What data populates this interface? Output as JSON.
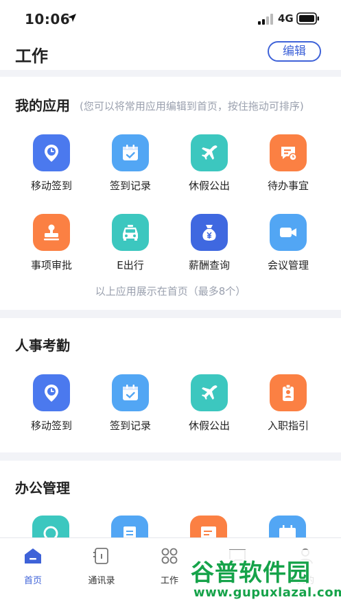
{
  "status": {
    "time": "10:06",
    "network": "4G"
  },
  "header": {
    "title": "工作",
    "edit_label": "编辑"
  },
  "my_apps": {
    "title": "我的应用",
    "hint": "(您可以将常用应用编辑到首页，按住拖动可排序)",
    "items": [
      {
        "label": "移动签到",
        "icon": "location-clock-icon",
        "color": "#4b79ee"
      },
      {
        "label": "签到记录",
        "icon": "calendar-check-icon",
        "color": "#52a6f4"
      },
      {
        "label": "休假公出",
        "icon": "airplane-icon",
        "color": "#3cc7bf"
      },
      {
        "label": "待办事宜",
        "icon": "todo-icon",
        "color": "#fb8043"
      },
      {
        "label": "事项审批",
        "icon": "stamp-icon",
        "color": "#fb8043"
      },
      {
        "label": "E出行",
        "icon": "taxi-icon",
        "color": "#3cc7bf"
      },
      {
        "label": "薪酬查询",
        "icon": "money-bag-icon",
        "color": "#3f68e0"
      },
      {
        "label": "会议管理",
        "icon": "video-camera-icon",
        "color": "#52a6f4"
      }
    ],
    "footnote": "以上应用展示在首页（最多8个）"
  },
  "hr": {
    "title": "人事考勤",
    "items": [
      {
        "label": "移动签到",
        "icon": "location-clock-icon"
      },
      {
        "label": "签到记录",
        "icon": "calendar-check-icon"
      },
      {
        "label": "休假公出",
        "icon": "airplane-icon"
      },
      {
        "label": "入职指引",
        "icon": "badge-icon"
      }
    ]
  },
  "office": {
    "title": "办公管理"
  },
  "tabs": [
    {
      "label": "首页",
      "icon": "home-icon",
      "active": true
    },
    {
      "label": "通讯录",
      "icon": "contacts-icon",
      "active": false
    },
    {
      "label": "工作",
      "icon": "grid-icon",
      "active": false
    },
    {
      "label": "",
      "icon": "message-icon",
      "active": false
    },
    {
      "label": "我的",
      "icon": "user-icon",
      "active": false
    }
  ],
  "watermark": {
    "title": "谷普软件园",
    "url": "www.gupuxlazal.com"
  }
}
